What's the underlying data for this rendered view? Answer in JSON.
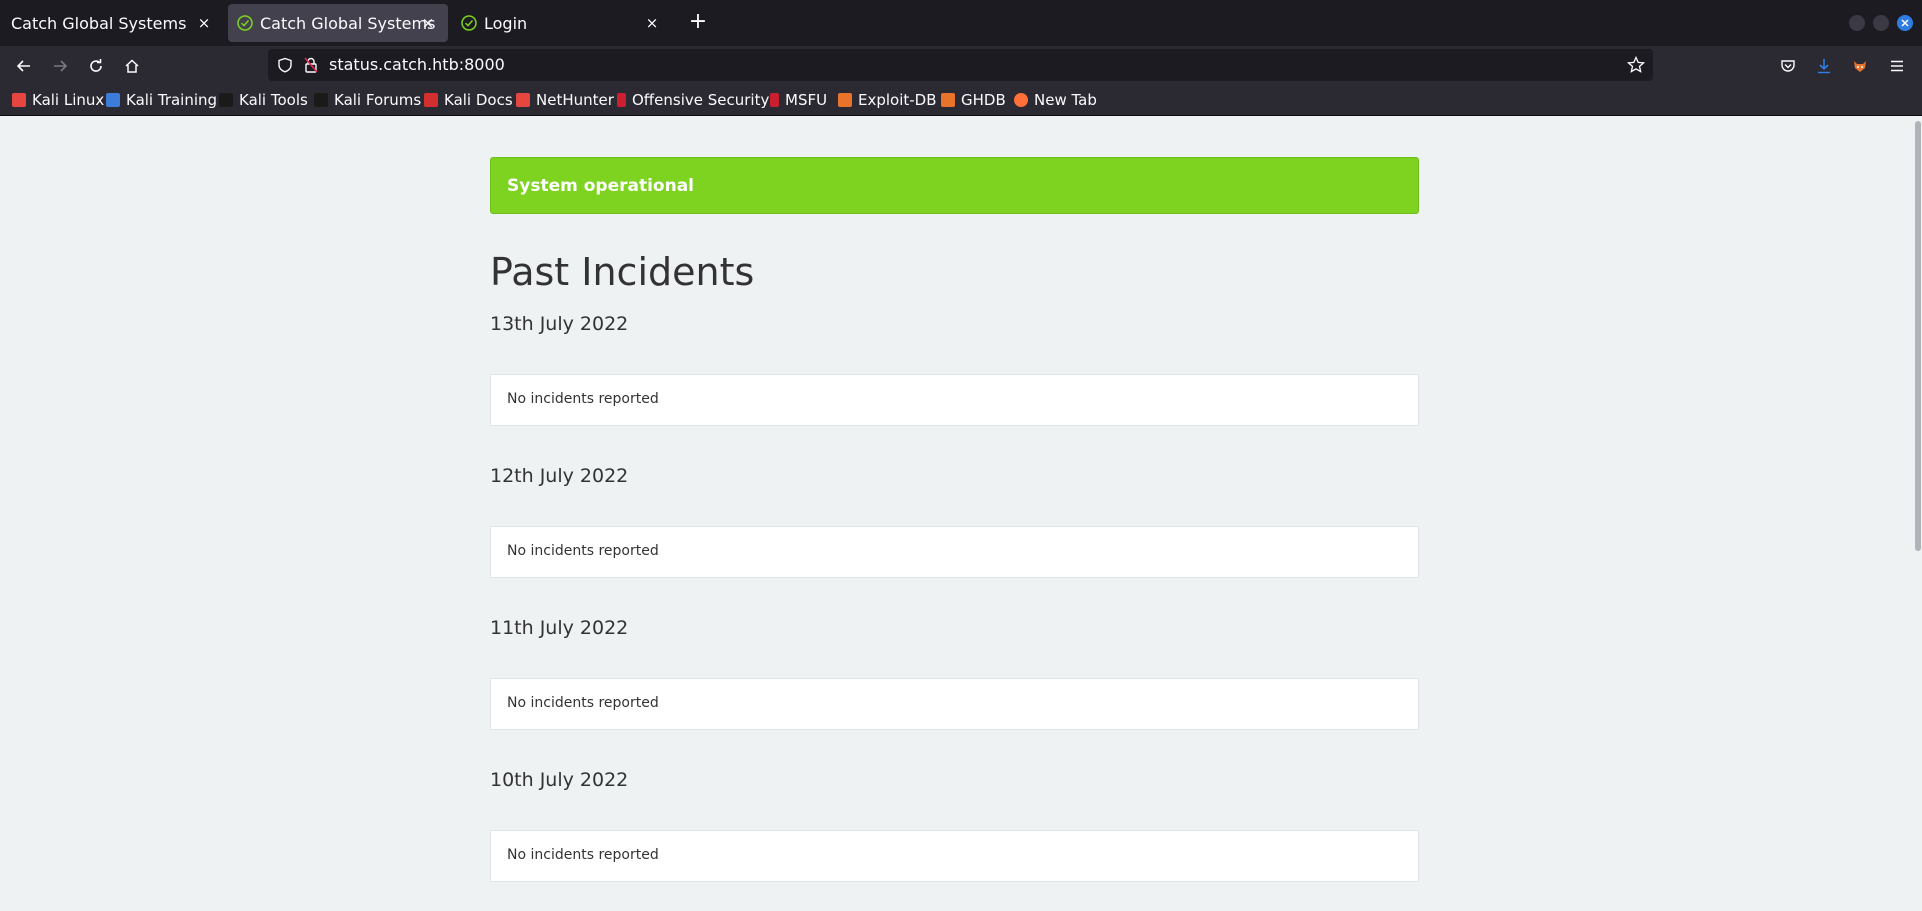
{
  "browser": {
    "tabs": [
      {
        "title": "Catch Global Systems",
        "active": false
      },
      {
        "title": "Catch Global Systems",
        "active": true
      },
      {
        "title": "Login",
        "active": false
      }
    ],
    "close_glyph": "×",
    "new_tab_glyph": "+",
    "url": "status.catch.htb:8000",
    "bookmarks": [
      {
        "label": "Kali Linux",
        "icon": "kali-icon",
        "color": "#e5463f"
      },
      {
        "label": "Kali Training",
        "icon": "kali-training-icon",
        "color": "#3b7dd8"
      },
      {
        "label": "Kali Tools",
        "icon": "kali-tools-icon",
        "color": "#1a1a1a"
      },
      {
        "label": "Kali Forums",
        "icon": "kali-forums-icon",
        "color": "#1a1a1a"
      },
      {
        "label": "Kali Docs",
        "icon": "kali-docs-icon",
        "color": "#d42f2f"
      },
      {
        "label": "NetHunter",
        "icon": "nethunter-icon",
        "color": "#e5463f"
      },
      {
        "label": "Offensive Security",
        "icon": "offsec-icon",
        "color": "#c8202f"
      },
      {
        "label": "MSFU",
        "icon": "msfu-icon",
        "color": "#c8202f"
      },
      {
        "label": "Exploit-DB",
        "icon": "exploit-db-icon",
        "color": "#e8742c"
      },
      {
        "label": "GHDB",
        "icon": "ghdb-icon",
        "color": "#e8742c"
      },
      {
        "label": "New Tab",
        "icon": "firefox-icon",
        "color": "#ff7139"
      }
    ]
  },
  "status": {
    "banner_text": "System operational",
    "banner_color": "#7ed321"
  },
  "incidents": {
    "title": "Past Incidents",
    "days": [
      {
        "date": "13th July 2022",
        "message": "No incidents reported"
      },
      {
        "date": "12th July 2022",
        "message": "No incidents reported"
      },
      {
        "date": "11th July 2022",
        "message": "No incidents reported"
      },
      {
        "date": "10th July 2022",
        "message": "No incidents reported"
      }
    ]
  }
}
